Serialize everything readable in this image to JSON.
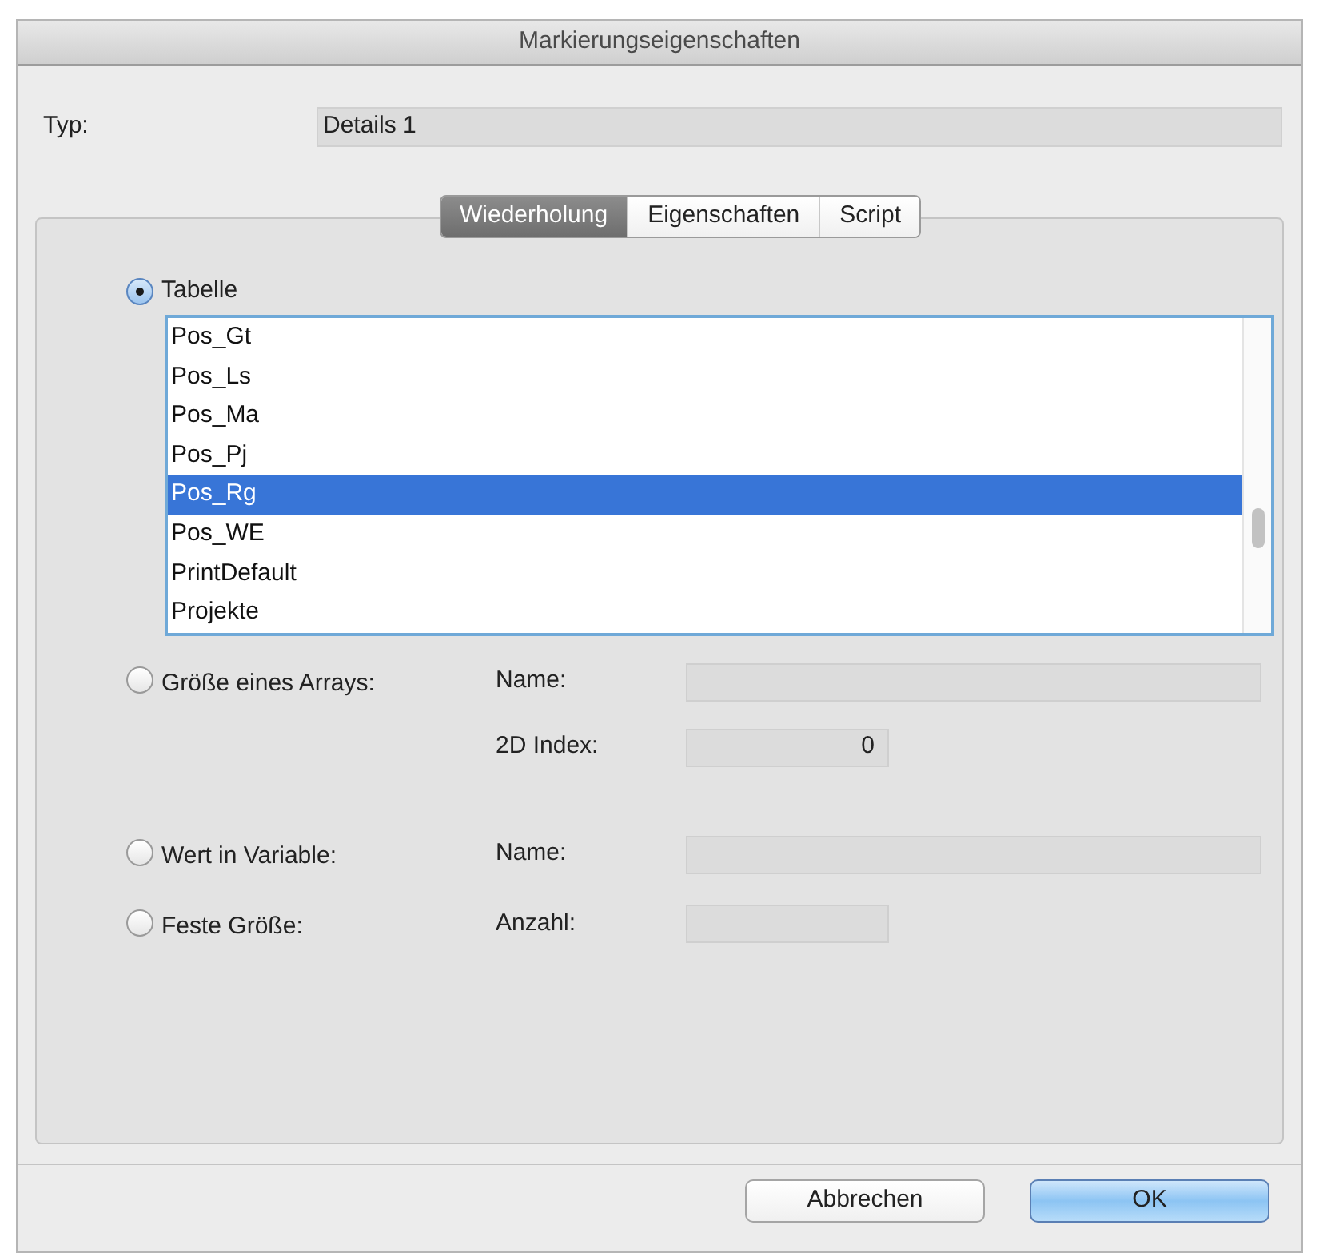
{
  "window": {
    "title": "Markierungseigenschaften"
  },
  "typ": {
    "label": "Typ:",
    "value": "Details 1"
  },
  "tabs": [
    {
      "label": "Wiederholung",
      "selected": true
    },
    {
      "label": "Eigenschaften",
      "selected": false
    },
    {
      "label": "Script",
      "selected": false
    }
  ],
  "table_option": {
    "label": "Tabelle",
    "selected": true
  },
  "table_list": [
    {
      "label": "Pos_Gt",
      "selected": false
    },
    {
      "label": "Pos_Ls",
      "selected": false
    },
    {
      "label": "Pos_Ma",
      "selected": false
    },
    {
      "label": "Pos_Pj",
      "selected": false
    },
    {
      "label": "Pos_Rg",
      "selected": true
    },
    {
      "label": "Pos_WE",
      "selected": false
    },
    {
      "label": "PrintDefault",
      "selected": false
    },
    {
      "label": "Projekte",
      "selected": false
    }
  ],
  "options": [
    {
      "label": "Größe eines Arrays:",
      "selected": false,
      "fields": [
        {
          "label": "Name:",
          "kind": "wide"
        },
        {
          "label": "2D Index:",
          "kind": "short",
          "value": "0"
        }
      ]
    },
    {
      "label": "Wert in Variable:",
      "selected": false,
      "fields": [
        {
          "label": "Name:",
          "kind": "wide"
        }
      ]
    },
    {
      "label": "Feste Größe:",
      "selected": false,
      "fields": [
        {
          "label": "Anzahl:",
          "kind": "short"
        }
      ]
    }
  ],
  "buttons": [
    {
      "label": "Abbrechen",
      "kind": "cancel"
    },
    {
      "label": "OK",
      "kind": "default"
    }
  ]
}
